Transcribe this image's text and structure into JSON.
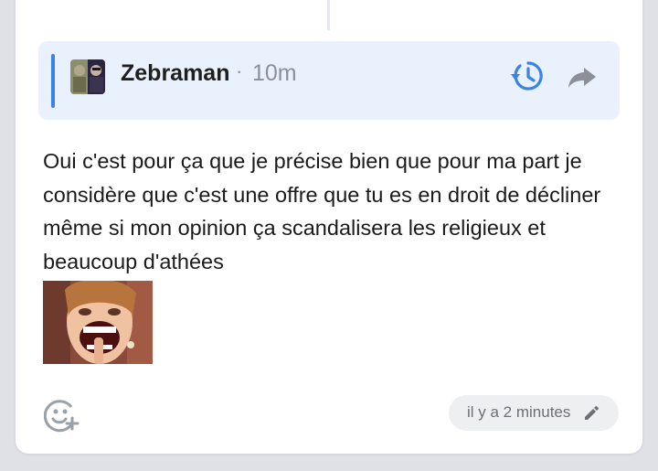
{
  "quote": {
    "author": "Zebraman",
    "separator": "·",
    "time": "10m",
    "icons": {
      "history": "history-icon",
      "share": "share-icon"
    }
  },
  "message": {
    "text": "Oui c'est pour ça que je précise bien que pour ma part je considère que c'est une offre que tu es en droit de décliner même si mon opinion ça scandalisera les religieux et beaucoup d'athées"
  },
  "footer": {
    "edited_label": "il y a 2 minutes",
    "icons": {
      "react": "add-reaction-icon",
      "edit": "pencil-icon"
    }
  },
  "colors": {
    "accent": "#3b82e6",
    "quote_bg": "#e9f1fc"
  }
}
